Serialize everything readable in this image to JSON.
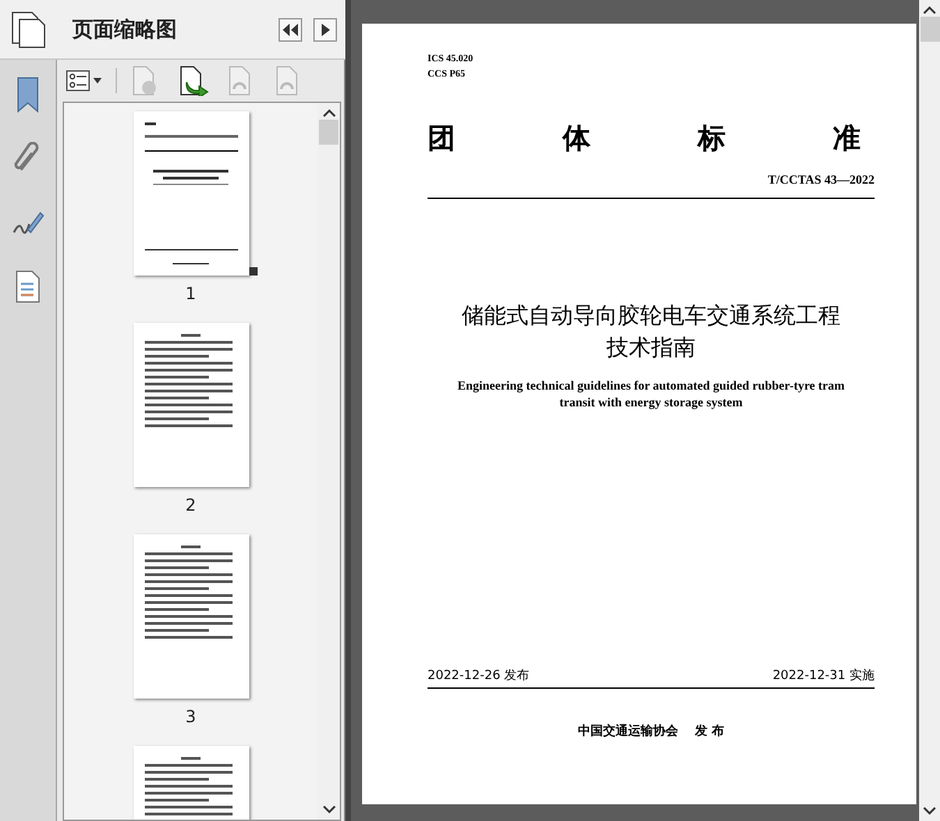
{
  "panel": {
    "title": "页面缩略图"
  },
  "toolbar": [
    {
      "kind": "options",
      "disabled": false
    },
    {
      "kind": "delete",
      "disabled": true
    },
    {
      "kind": "insert",
      "disabled": false
    },
    {
      "kind": "rotate-left",
      "disabled": true
    },
    {
      "kind": "rotate-right",
      "disabled": true
    }
  ],
  "sidebar": {
    "items": [
      {
        "kind": "bookmark",
        "selected": false
      },
      {
        "kind": "attachment",
        "selected": false
      },
      {
        "kind": "signature",
        "selected": false
      },
      {
        "kind": "document",
        "selected": false
      }
    ]
  },
  "thumbnails": [
    {
      "kind": "cover",
      "label": "1",
      "selected": true
    },
    {
      "kind": "toc",
      "label": "2",
      "selected": false
    },
    {
      "kind": "toc",
      "label": "3",
      "selected": false
    },
    {
      "kind": "toc",
      "selected": false
    }
  ],
  "document": {
    "codes": [
      "ICS 45.020",
      "CCS P65"
    ],
    "heading": [
      "团",
      "体",
      "标",
      "准"
    ],
    "number": "T/CCTAS 43—2022",
    "title": [
      "储能式自动导向胶轮电车交通系统工程",
      "技术指南"
    ],
    "subtitle": [
      "Engineering technical guidelines for automated guided rubber-tyre tram",
      "transit with energy storage system"
    ],
    "issue_date": "2022-12-26 发布",
    "effective_date": "2022-12-31 实施",
    "publisher": "中国交通运输协会　 发 布"
  }
}
